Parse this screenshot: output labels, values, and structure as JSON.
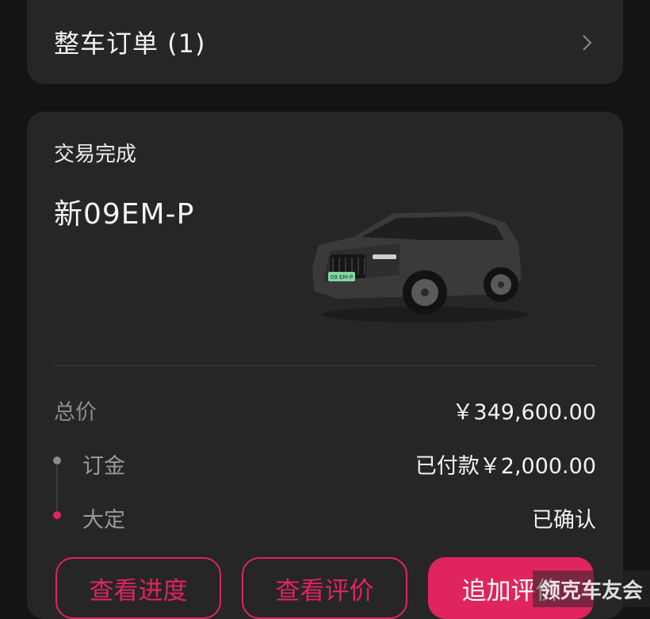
{
  "order_header": {
    "title": "整车订单 (1)"
  },
  "order": {
    "status": "交易完成",
    "model": "新09EM-P",
    "car_plate_text": "09 EM-P",
    "total": {
      "label": "总价",
      "value": "￥349,600.00"
    },
    "deposit": {
      "label": "订金",
      "value": "已付款￥2,000.00"
    },
    "final": {
      "label": "大定",
      "value": "已确认"
    }
  },
  "actions": {
    "progress_label": "查看进度",
    "review_label": "查看评价",
    "add_review_label": "追加评价"
  },
  "watermark": "领克车友会",
  "colors": {
    "accent": "#e0245e",
    "background": "#141414",
    "card": "#262626"
  },
  "icons": {
    "chevron": "chevron-right-icon"
  }
}
